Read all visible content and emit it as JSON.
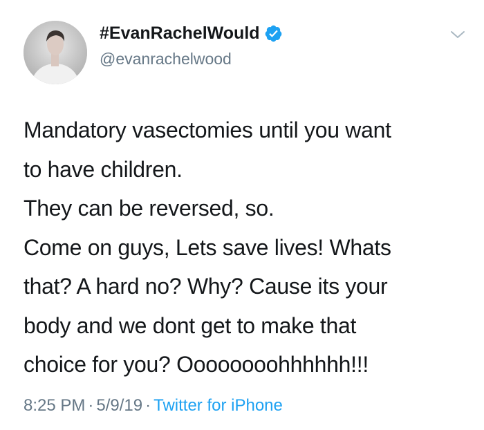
{
  "account": {
    "display_name": "#EvanRachelWould",
    "handle": "@evanrachelwood",
    "verified": true,
    "verified_icon": "verified-badge-icon",
    "verified_color": "#1da1f2"
  },
  "tweet": {
    "lines": [
      "Mandatory vasectomies until you want",
      "to have children.",
      "They can be reversed, so.",
      "Come on guys, Lets save lives! Whats",
      "that? A hard no? Why? Cause its your",
      "body and we dont get to make that",
      "choice for you? Oooooooohhhhhh!!!"
    ]
  },
  "meta": {
    "time": "8:25 PM",
    "separator": "·",
    "date": "5/9/19",
    "source": "Twitter for iPhone",
    "source_color": "#1da1f2",
    "muted_color": "#657786"
  },
  "menu": {
    "icon": "chevron-down-icon"
  }
}
